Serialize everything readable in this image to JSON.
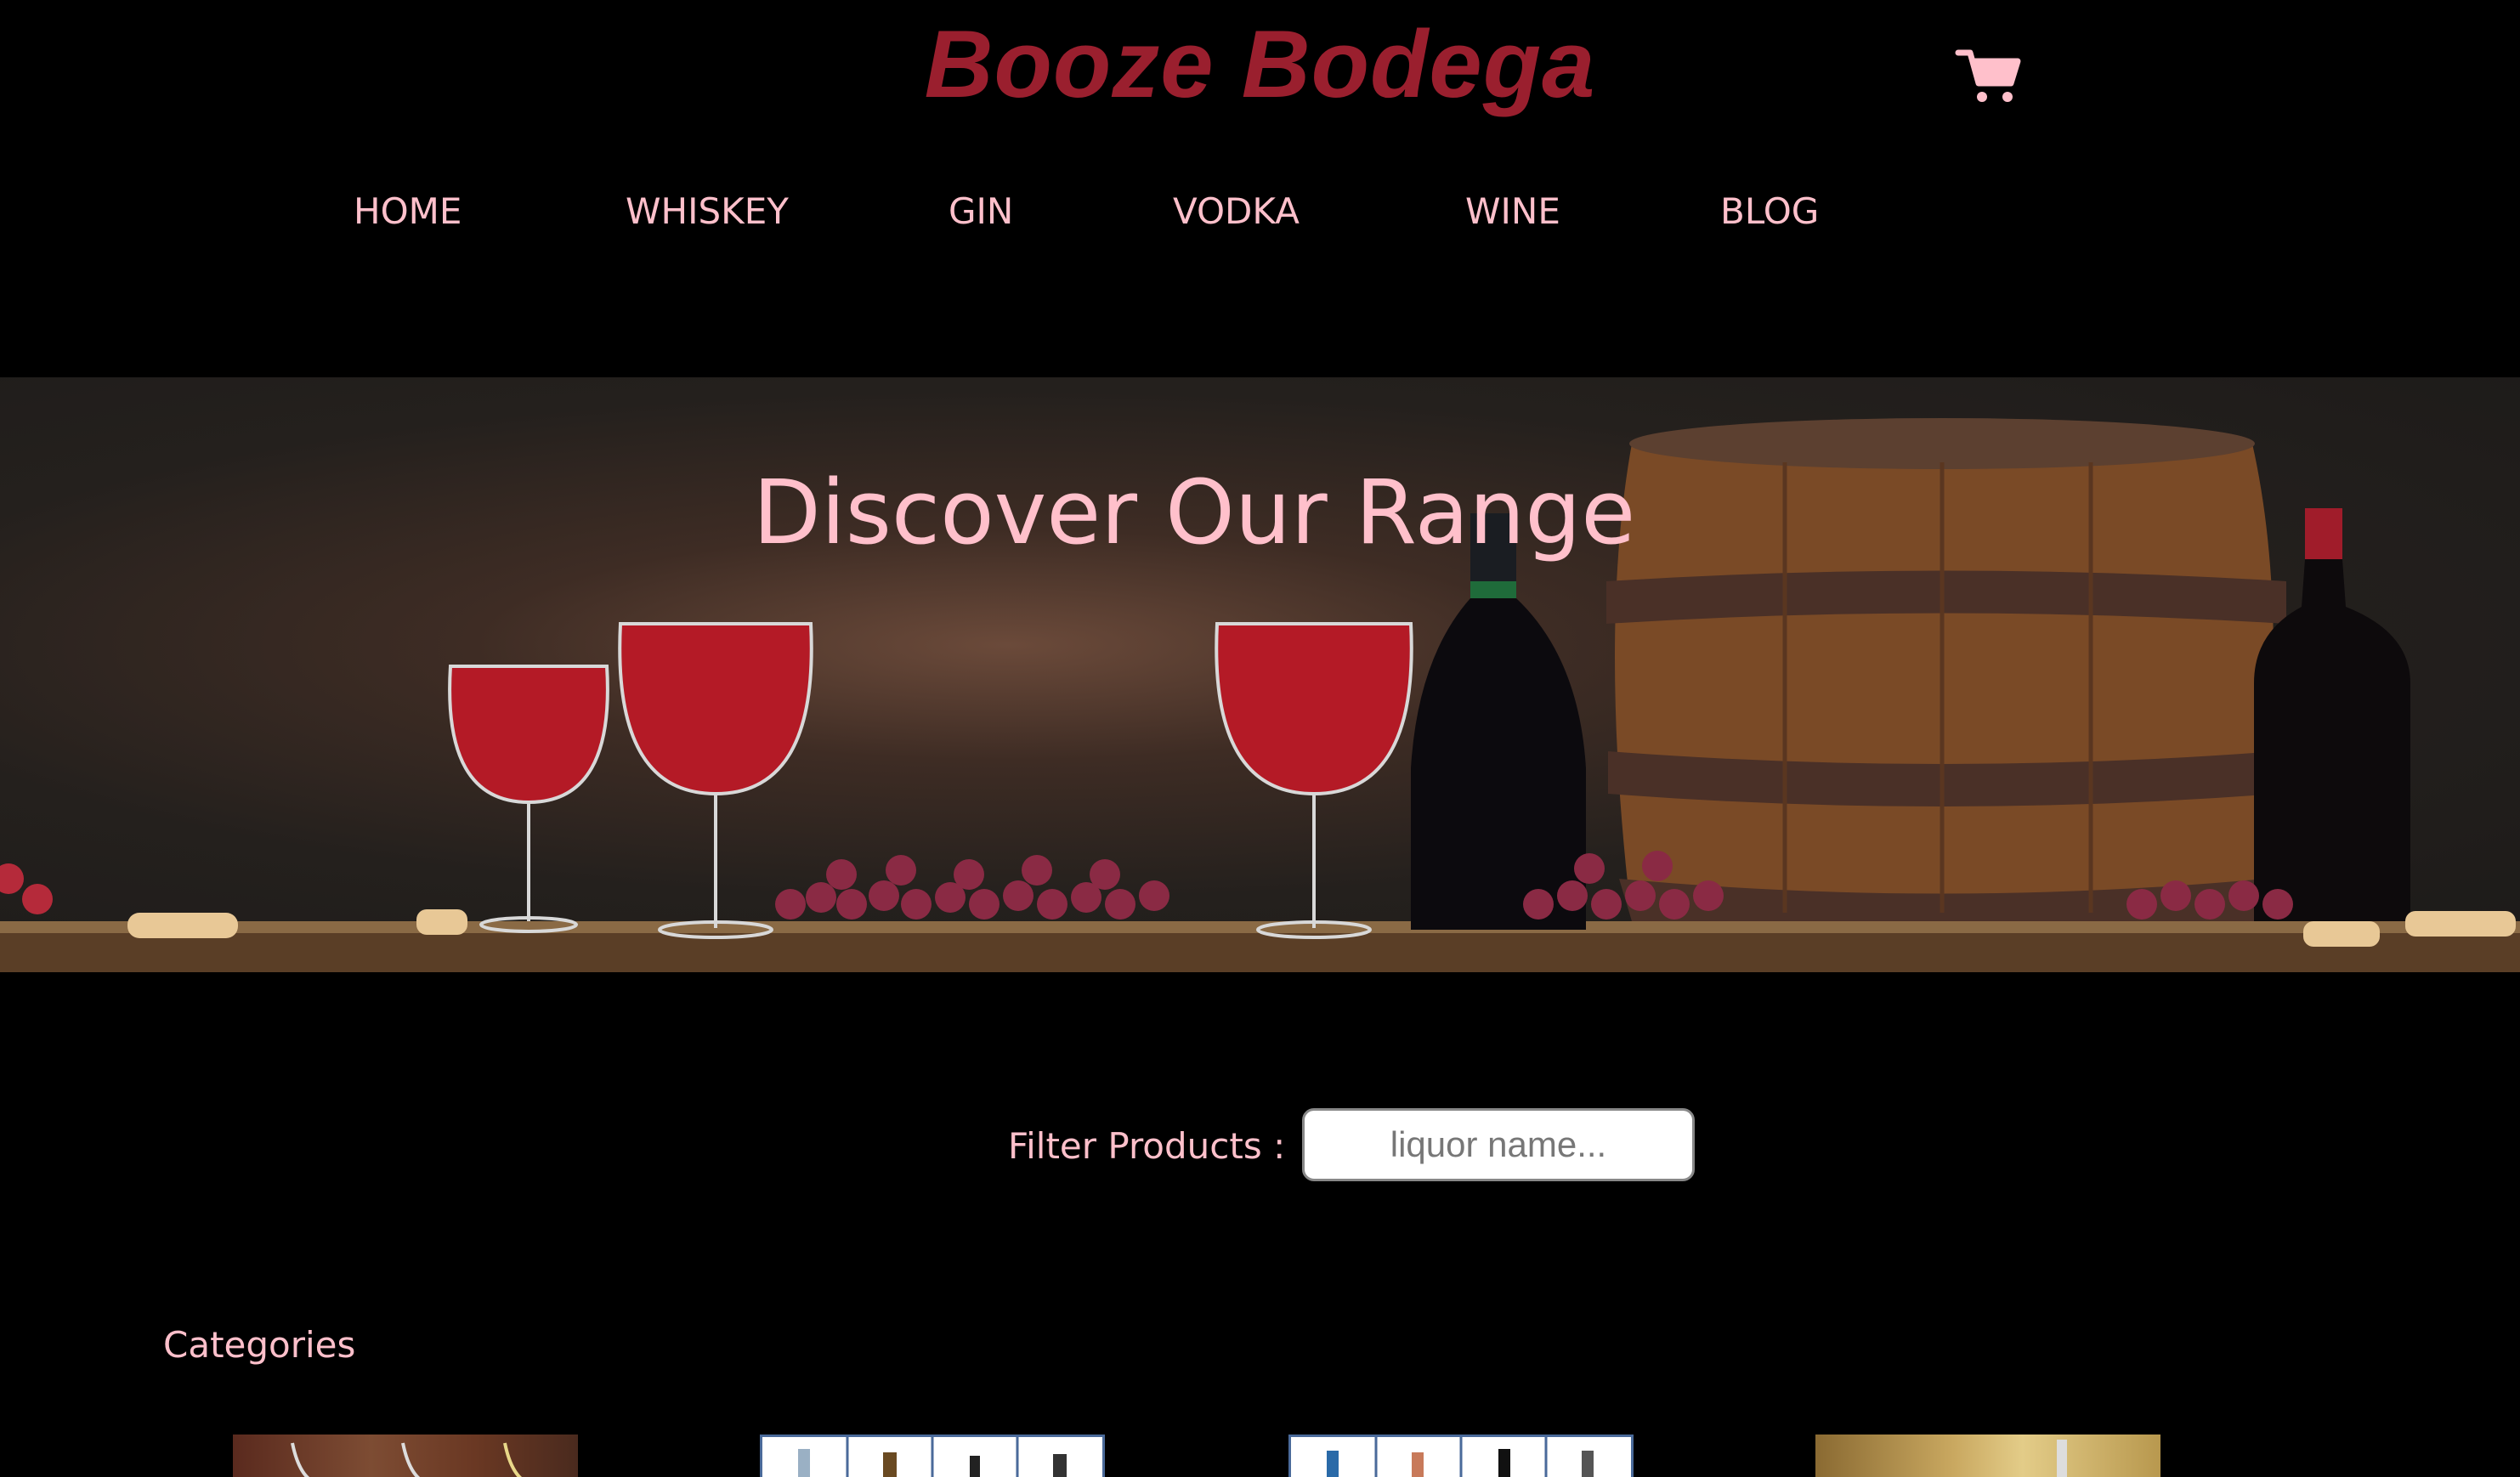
{
  "header": {
    "brand": "Booze Bodega",
    "cart_icon": "shopping-cart-icon",
    "brand_color": "#9a1f2e",
    "accent_color": "#ffc0cb"
  },
  "nav": {
    "items": [
      {
        "label": "HOME"
      },
      {
        "label": "WHISKEY"
      },
      {
        "label": "GIN"
      },
      {
        "label": "VODKA"
      },
      {
        "label": "WINE"
      },
      {
        "label": "BLOG"
      }
    ]
  },
  "hero": {
    "title": "Discover Our Range"
  },
  "filter": {
    "label": "Filter Products :",
    "placeholder": "liquor name...",
    "value": ""
  },
  "categories": {
    "heading": "Categories"
  }
}
